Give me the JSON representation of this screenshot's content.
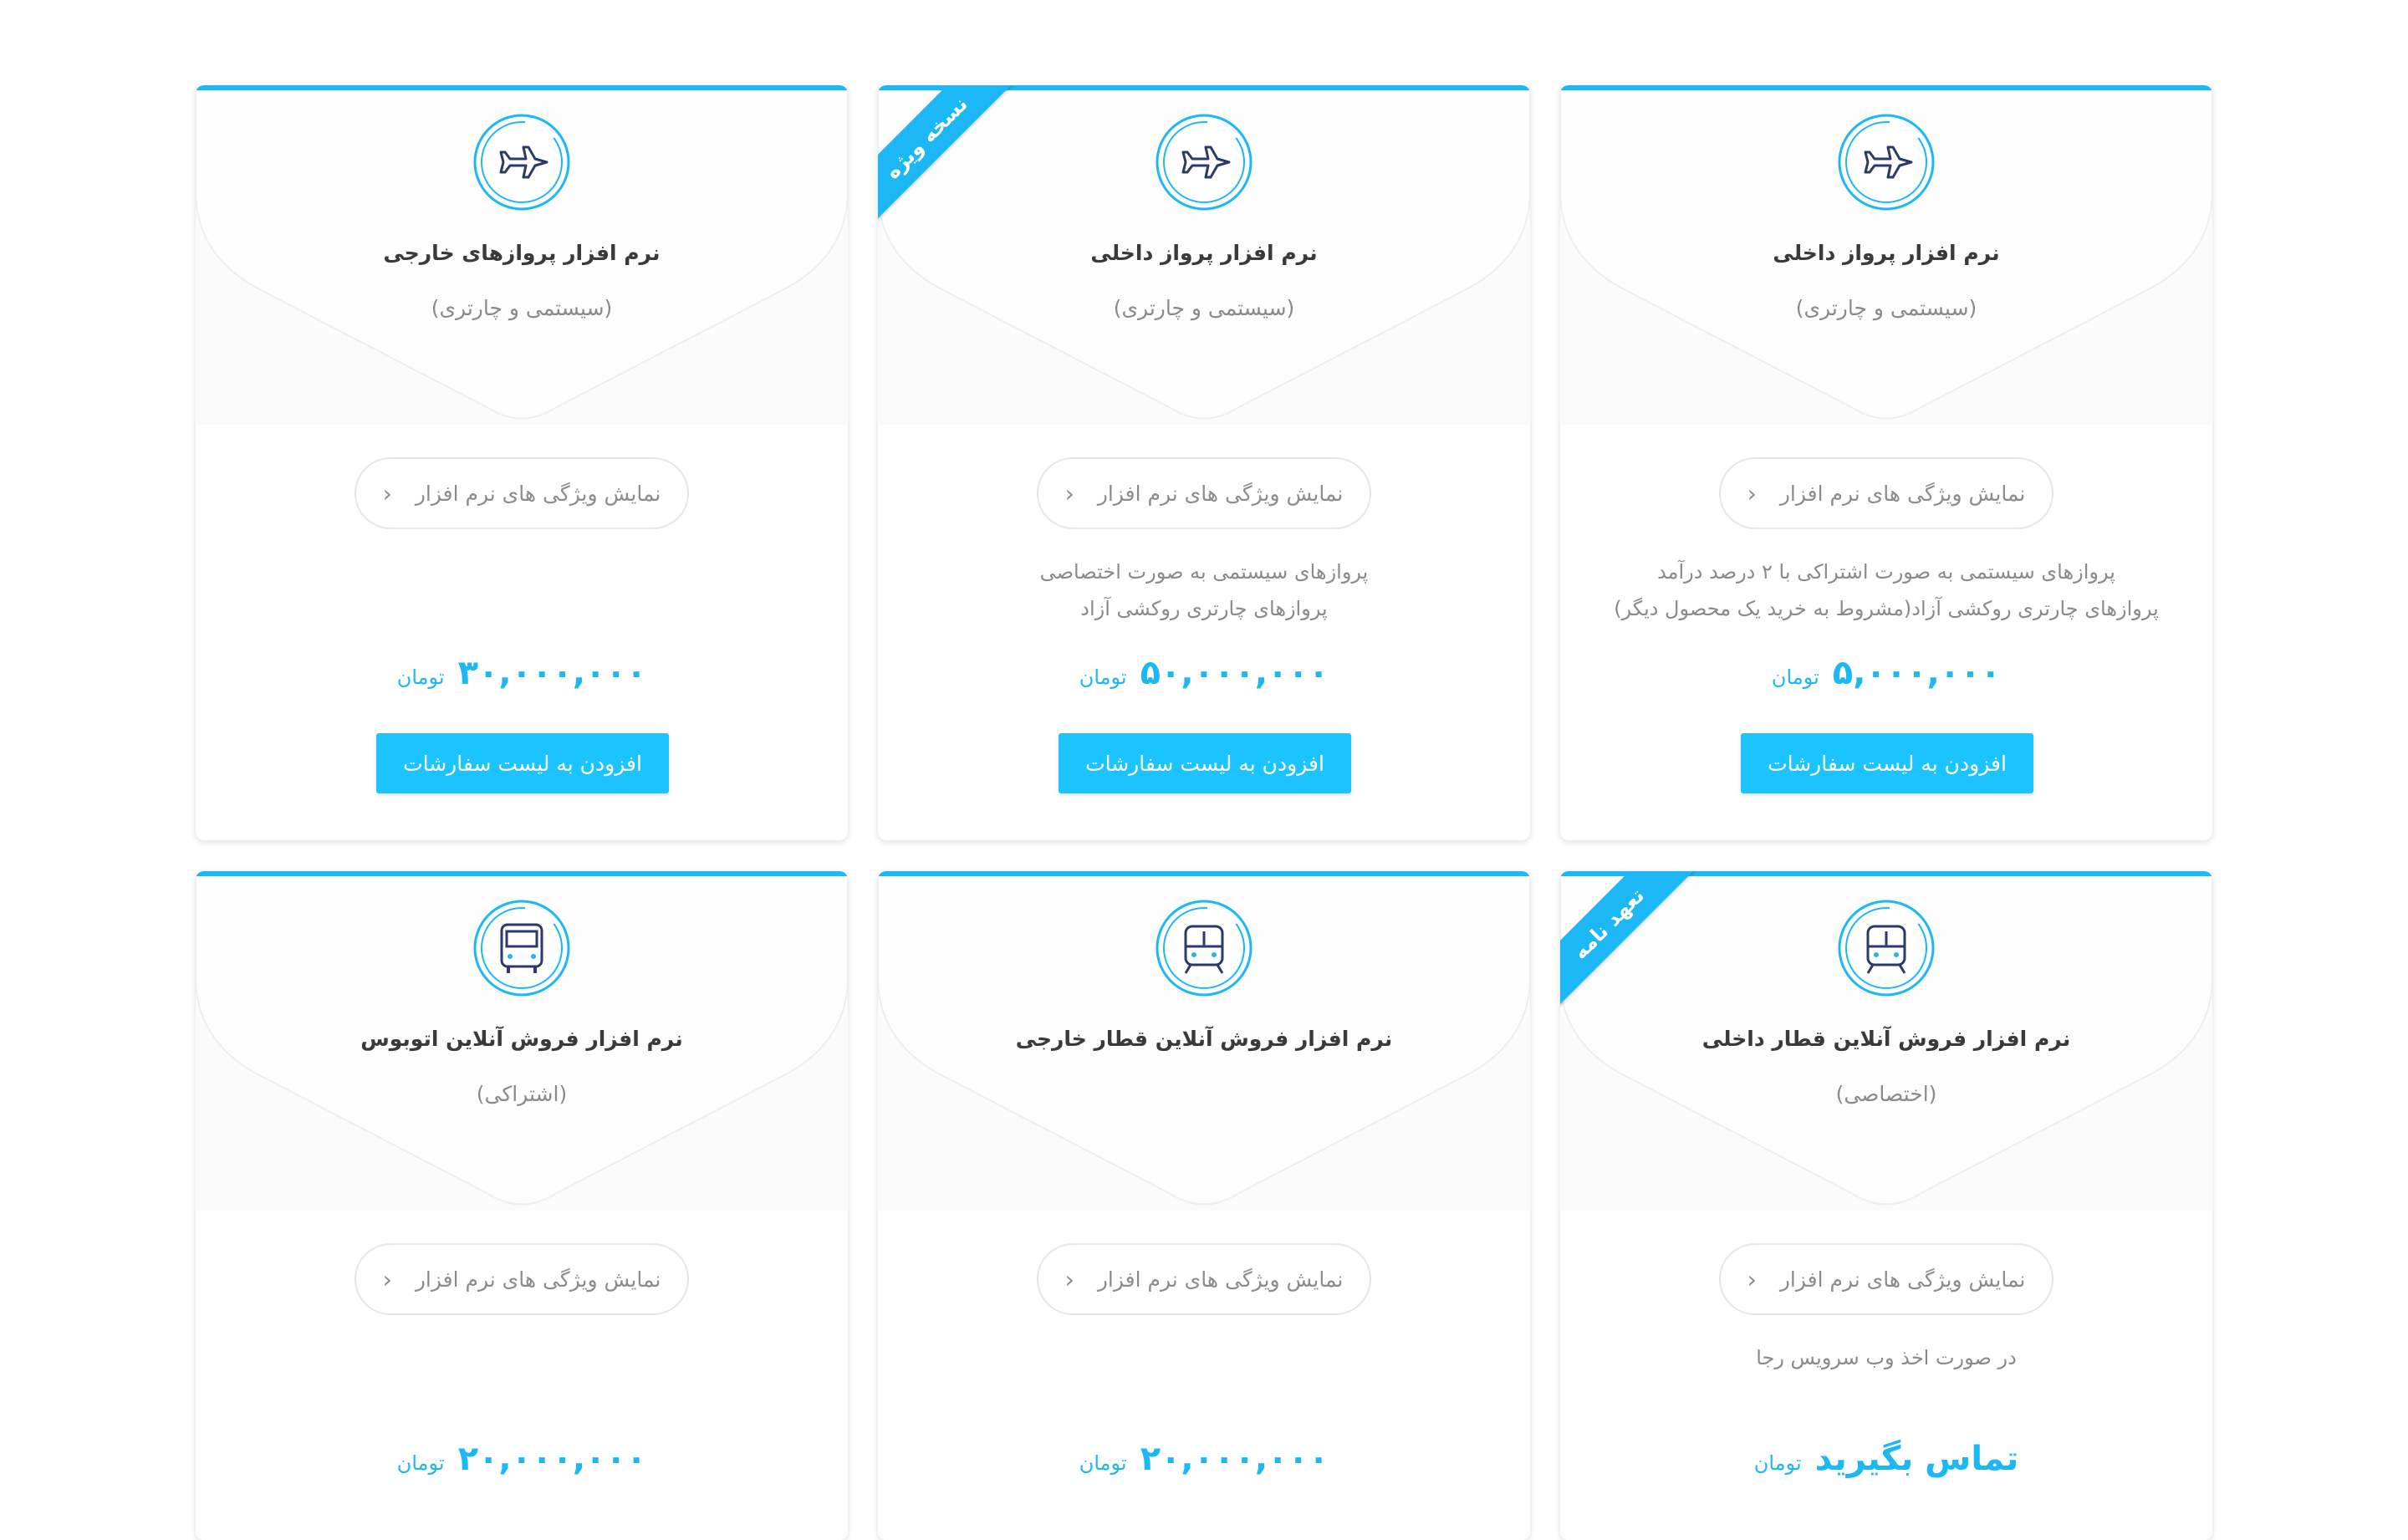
{
  "colors": {
    "accent": "#1bb8f5",
    "button": "#1cc4ff",
    "icon_dark": "#2b3a6b"
  },
  "cards": [
    {
      "icon": "airplane-icon",
      "title": "نرم افزار پرواز داخلی",
      "subtitle": "(سیستمی و چارتری)",
      "features": "نمایش ویژگی های نرم افزار",
      "desc1": "پروازهای سیستمی به صورت اشتراکی با ۲ درصد درآمد",
      "desc2": "پروازهای چارتری روکشی آزاد(مشروط به خرید یک محصول دیگر)",
      "price": "۵,۰۰۰,۰۰۰",
      "unit": "تومان",
      "cta": "افزودن به لیست سفارشات",
      "ribbon": ""
    },
    {
      "icon": "airplane-icon",
      "title": "نرم افزار پرواز داخلی",
      "subtitle": "(سیستمی و چارتری)",
      "features": "نمایش ویژگی های نرم افزار",
      "desc1": "پروازهای سیستمی به صورت اختصاصی",
      "desc2": "پروازهای چارتری روکشی آزاد",
      "price": "۵۰,۰۰۰,۰۰۰",
      "unit": "تومان",
      "cta": "افزودن به لیست سفارشات",
      "ribbon": "نسخه ویژه"
    },
    {
      "icon": "airplane-icon",
      "title": "نرم افزار پروازهای خارجی",
      "subtitle": "(سیستمی و چارتری)",
      "features": "نمایش ویژگی های نرم افزار",
      "desc1": "",
      "desc2": "",
      "price": "۳۰,۰۰۰,۰۰۰",
      "unit": "تومان",
      "cta": "افزودن به لیست سفارشات",
      "ribbon": ""
    },
    {
      "icon": "train-icon",
      "title": "نرم افزار فروش آنلاین قطار داخلی",
      "subtitle": "(اختصاصی)",
      "features": "نمایش ویژگی های نرم افزار",
      "desc1": "در صورت اخذ وب سرویس رجا",
      "desc2": "",
      "price": "تماس بگیرید",
      "unit": "تومان",
      "cta": "",
      "ribbon": "تعهد نامه"
    },
    {
      "icon": "train-icon",
      "title": "نرم افزار فروش آنلاین قطار خارجی",
      "subtitle": "",
      "features": "نمایش ویژگی های نرم افزار",
      "desc1": "",
      "desc2": "",
      "price": "۲۰,۰۰۰,۰۰۰",
      "unit": "تومان",
      "cta": "",
      "ribbon": ""
    },
    {
      "icon": "bus-icon",
      "title": "نرم افزار فروش آنلاین اتوبوس",
      "subtitle": "(اشتراکی)",
      "features": "نمایش ویژگی های نرم افزار",
      "desc1": "",
      "desc2": "",
      "price": "۲۰,۰۰۰,۰۰۰",
      "unit": "تومان",
      "cta": "",
      "ribbon": ""
    }
  ]
}
